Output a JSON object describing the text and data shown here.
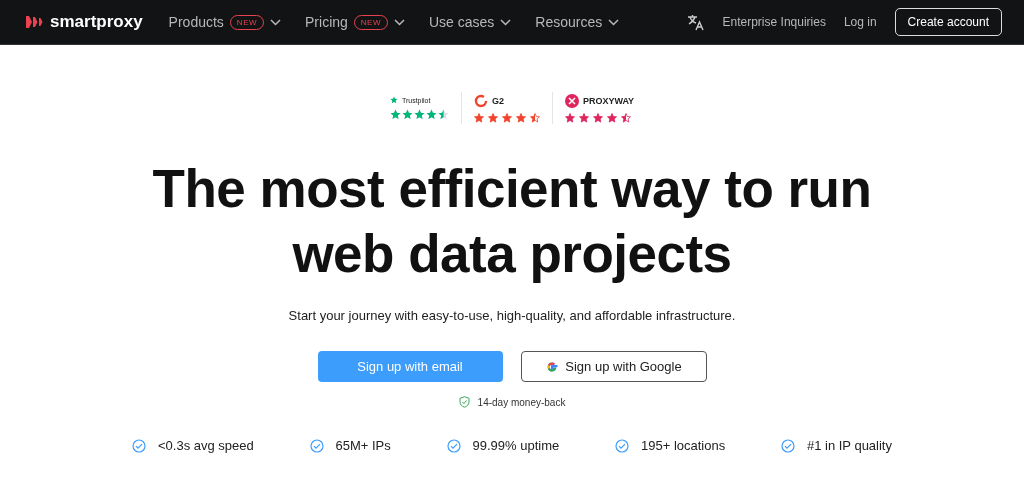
{
  "nav": {
    "brand": "smartproxy",
    "items": [
      {
        "label": "Products",
        "badge": "NEW"
      },
      {
        "label": "Pricing",
        "badge": "NEW"
      },
      {
        "label": "Use cases"
      },
      {
        "label": "Resources"
      }
    ],
    "enterprise": "Enterprise Inquiries",
    "login": "Log in",
    "create": "Create account"
  },
  "ratings": [
    {
      "kind": "trustpilot",
      "name": "Trustpilot",
      "stars": 4.5
    },
    {
      "kind": "g2",
      "name": "G2",
      "stars": 4.5
    },
    {
      "kind": "proxyway",
      "name": "PROXYWAY",
      "stars": 4.5
    }
  ],
  "hero": {
    "title_lines": [
      "The most efficient way to run",
      "web data projects"
    ],
    "subtitle": "Start your journey with easy-to-use, high-quality, and affordable infrastructure.",
    "email_button": "Sign up with email",
    "google_button": "Sign up with Google",
    "guarantee": "14-day money-back"
  },
  "features": [
    "<0.3s avg speed",
    "65M+ IPs",
    "99.99% uptime",
    "195+ locations",
    "#1 in IP quality"
  ]
}
